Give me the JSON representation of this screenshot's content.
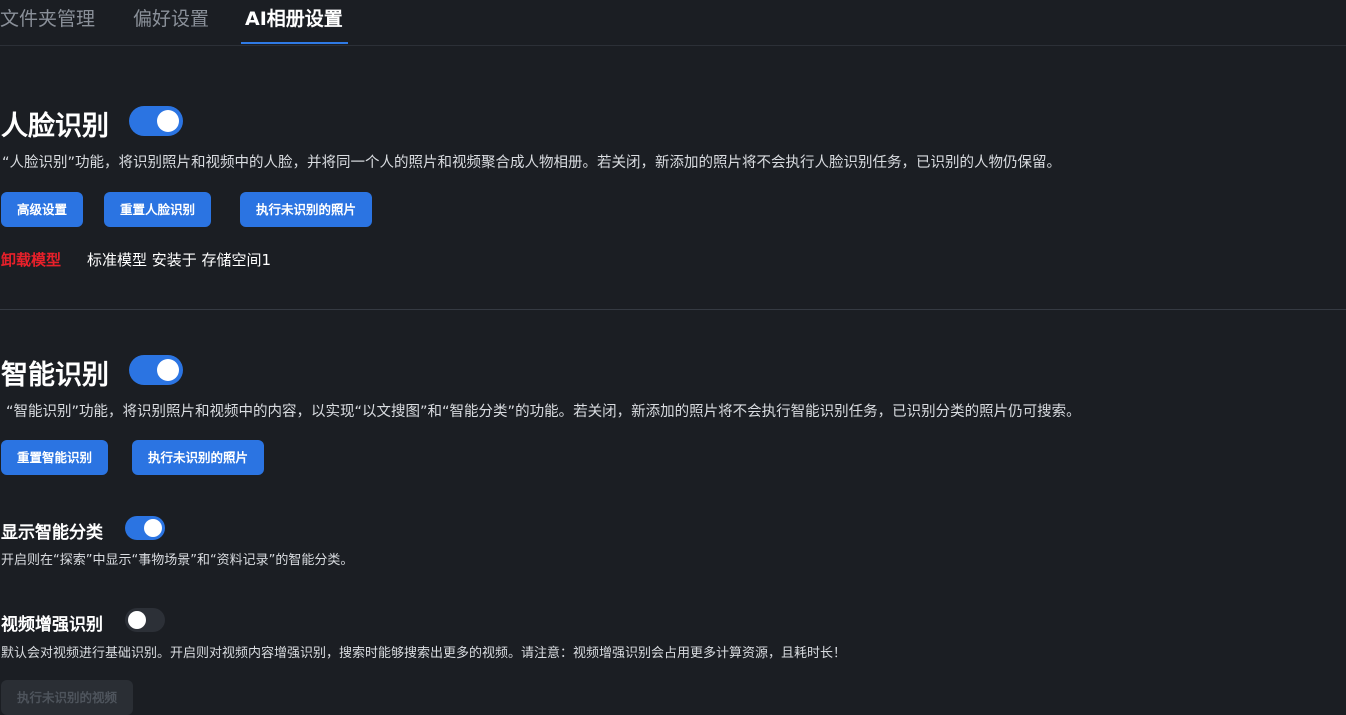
{
  "tabs": [
    {
      "label": "文件夹管理",
      "active": false
    },
    {
      "label": "偏好设置",
      "active": false
    },
    {
      "label": "AI相册设置",
      "active": true
    }
  ],
  "face": {
    "title": "人脸识别",
    "enabled": true,
    "description": "“人脸识别”功能，将识别照片和视频中的人脸，并将同一个人的照片和视频聚合成人物相册。若关闭，新添加的照片将不会执行人脸识别任务，已识别的人物仍保留。",
    "buttons": {
      "advanced": "高级设置",
      "reset": "重置人脸识别",
      "run_unrecognized": "执行未识别的照片"
    },
    "uninstall_label": "卸载模型",
    "model_info": "标准模型 安装于 存储空间1"
  },
  "smart": {
    "title": "智能识别",
    "enabled": true,
    "description": "“智能识别”功能，将识别照片和视频中的内容，以实现“以文搜图”和“智能分类”的功能。若关闭，新添加的照片将不会执行智能识别任务，已识别分类的照片仍可搜索。",
    "buttons": {
      "reset": "重置智能识别",
      "run_unrecognized": "执行未识别的照片"
    }
  },
  "show_smart_category": {
    "title": "显示智能分类",
    "enabled": true,
    "description": "开启则在“探索”中显示“事物场景”和“资料记录”的智能分类。"
  },
  "video_enhance": {
    "title": "视频增强识别",
    "enabled": false,
    "description": "默认会对视频进行基础识别。开启则对视频内容增强识别，搜索时能够搜索出更多的视频。请注意：视频增强识别会占用更多计算资源，且耗时长！",
    "button": "执行未识别的视频",
    "button_disabled": true
  },
  "colors": {
    "accent": "#2b74e2",
    "danger": "#e8202a",
    "background": "#1b1e23"
  }
}
